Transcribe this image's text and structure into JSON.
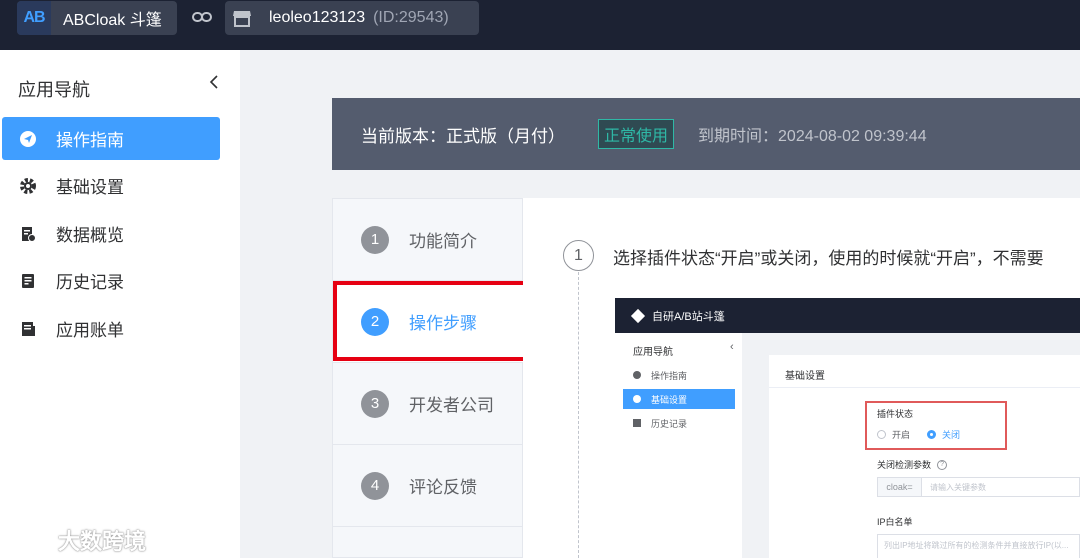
{
  "topbar": {
    "logo_text": "AB",
    "app_name": "ABCloak 斗篷",
    "user_name": "leoleo123123",
    "user_id": "(ID:29543)"
  },
  "sidebar": {
    "title": "应用导航",
    "collapse_icon": "chevron-left-icon",
    "items": [
      {
        "label": "操作指南",
        "icon": "compass-icon",
        "active": true
      },
      {
        "label": "基础设置",
        "icon": "gear-icon",
        "active": false
      },
      {
        "label": "数据概览",
        "icon": "data-report-icon",
        "active": false
      },
      {
        "label": "历史记录",
        "icon": "document-icon",
        "active": false
      },
      {
        "label": "应用账单",
        "icon": "bill-icon",
        "active": false
      }
    ]
  },
  "watermark": "大数跨境",
  "banner": {
    "version_label": "当前版本：正式版（月付）",
    "status": "正常使用",
    "expire": "到期时间：2024-08-02 09:39:44"
  },
  "steps": [
    {
      "num": "1",
      "label": "功能简介",
      "active": false
    },
    {
      "num": "2",
      "label": "操作步骤",
      "active": true
    },
    {
      "num": "3",
      "label": "开发者公司",
      "active": false
    },
    {
      "num": "4",
      "label": "评论反馈",
      "active": false
    }
  ],
  "content": {
    "step_number": "1",
    "step_text": "选择插件状态“开启”或关闭，使用的时候就“开启”，不需要"
  },
  "embedded": {
    "app_title": "自研A/B站斗篷",
    "nav_title": "应用导航",
    "nav_collapse": "‹",
    "nav_items": [
      "操作指南",
      "基础设置",
      "历史记录"
    ],
    "card_title": "基础设置",
    "plugin_status_label": "插件状态",
    "radio_on": "开启",
    "radio_off": "关闭",
    "param_label": "关闭检测参数",
    "param_help": "?",
    "input_prefix": "cloak=",
    "input_placeholder": "请输入关键参数",
    "ip_label": "IP白名单",
    "ip_placeholder": "列出IP地址将跳过所有的检测条件并直接放行IP(以..."
  },
  "colors": {
    "accent": "#409eff",
    "topbar_bg": "#1c2233",
    "banner_bg": "#545c6e",
    "status_green": "#2fb8a6",
    "highlight_red": "#e60012"
  }
}
